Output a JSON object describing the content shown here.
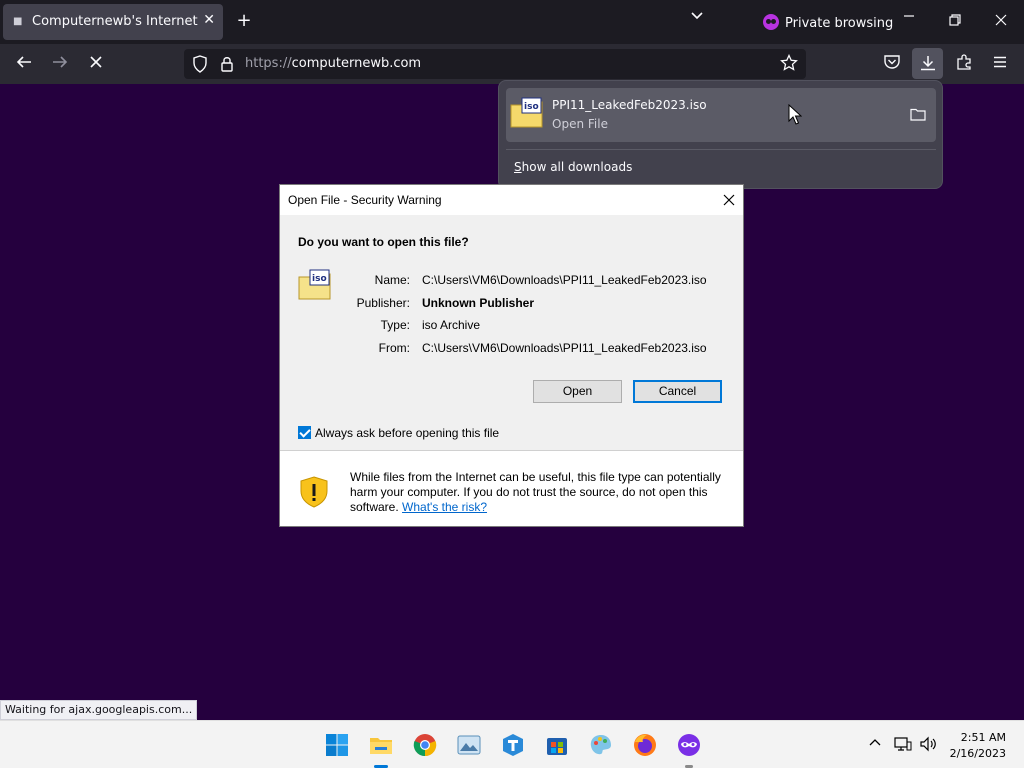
{
  "browser": {
    "tab_title": "Computernewb's Internet Pub",
    "private_label": "Private browsing",
    "url_protocol": "https://",
    "url_host": "computernewb.com"
  },
  "downloads": {
    "file_name": "PPI11_LeakedFeb2023.iso",
    "status": "Open File",
    "show_all": "Show all downloads",
    "show_all_accesskey": "S"
  },
  "dialog": {
    "title": "Open File - Security Warning",
    "question": "Do you want to open this file?",
    "file_icon_label": "iso",
    "fields": {
      "name_label": "Name:",
      "name_value": "C:\\Users\\VM6\\Downloads\\PPI11_LeakedFeb2023.iso",
      "publisher_label": "Publisher:",
      "publisher_value": "Unknown Publisher",
      "type_label": "Type:",
      "type_value": "iso Archive",
      "from_label": "From:",
      "from_value": "C:\\Users\\VM6\\Downloads\\PPI11_LeakedFeb2023.iso"
    },
    "open_label": "Open",
    "cancel_label": "Cancel",
    "always_ask_label": "Always ask before opening this file",
    "always_ask_checked": true,
    "warning_text": "While files from the Internet can be useful, this file type can potentially harm your computer. If you do not trust the source, do not open this software.",
    "risk_link": "What's the risk?"
  },
  "status_text": "Waiting for ajax.googleapis.com...",
  "taskbar": {
    "time": "2:51 AM",
    "date": "2/16/2023",
    "apps": [
      "windows-start-icon",
      "file-explorer-icon",
      "chrome-icon",
      "photos-icon",
      "teams-icon",
      "store-icon",
      "paint-icon",
      "firefox-icon",
      "firefox-private-icon"
    ]
  },
  "colors": {
    "page_background": "#25003e",
    "accent": "#0078d7",
    "link": "#0066cc"
  }
}
